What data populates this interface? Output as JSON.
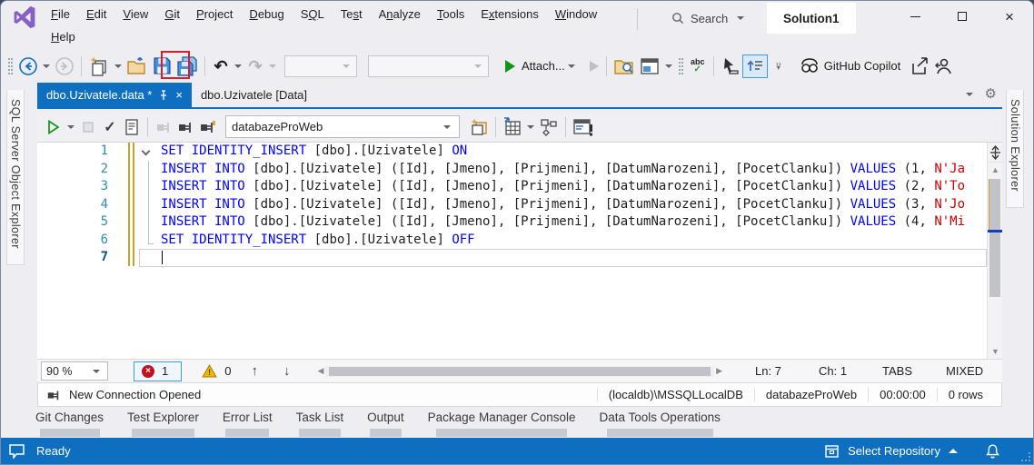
{
  "titlebar": {
    "menus": [
      {
        "label": "File",
        "u": 0
      },
      {
        "label": "Edit",
        "u": 0
      },
      {
        "label": "View",
        "u": 0
      },
      {
        "label": "Git",
        "u": 0
      },
      {
        "label": "Project",
        "u": 0
      },
      {
        "label": "Debug",
        "u": 0
      },
      {
        "label": "SQL",
        "u": 1
      },
      {
        "label": "Test",
        "u": 2
      },
      {
        "label": "Analyze",
        "u": 1
      },
      {
        "label": "Tools",
        "u": 0
      },
      {
        "label": "Extensions",
        "u": 1
      },
      {
        "label": "Window",
        "u": 0
      },
      {
        "label": "Help",
        "u": 0
      }
    ],
    "search_label": "Search",
    "solution_name": "Solution1"
  },
  "toolbar": {
    "attach_label": "Attach...",
    "copilot_label": "GitHub Copilot"
  },
  "side_panels": {
    "left": "SQL Server Object Explorer",
    "right": "Solution Explorer"
  },
  "tabs": [
    {
      "label": "dbo.Uzivatele.data *"
    },
    {
      "label": "dbo.Uzivatele [Data]"
    }
  ],
  "sql_toolbar": {
    "database": "databazeProWeb"
  },
  "editor": {
    "lines": [
      {
        "n": "1",
        "seg": [
          [
            "SET IDENTITY_INSERT",
            "k"
          ],
          [
            " [dbo].[Uzivatele] ",
            "p"
          ],
          [
            "ON",
            "k"
          ]
        ]
      },
      {
        "n": "2",
        "seg": [
          [
            "INSERT INTO",
            "k"
          ],
          [
            " [dbo].[Uzivatele] ([Id], [Jmeno], [Prijmeni], [DatumNarozeni], [PocetClanku]) ",
            "p"
          ],
          [
            "VALUES",
            "k"
          ],
          [
            " (1, ",
            "p"
          ],
          [
            "N'Ja",
            "s"
          ]
        ]
      },
      {
        "n": "3",
        "seg": [
          [
            "INSERT INTO",
            "k"
          ],
          [
            " [dbo].[Uzivatele] ([Id], [Jmeno], [Prijmeni], [DatumNarozeni], [PocetClanku]) ",
            "p"
          ],
          [
            "VALUES",
            "k"
          ],
          [
            " (2, ",
            "p"
          ],
          [
            "N'To",
            "s"
          ]
        ]
      },
      {
        "n": "4",
        "seg": [
          [
            "INSERT INTO",
            "k"
          ],
          [
            " [dbo].[Uzivatele] ([Id], [Jmeno], [Prijmeni], [DatumNarozeni], [PocetClanku]) ",
            "p"
          ],
          [
            "VALUES",
            "k"
          ],
          [
            " (3, ",
            "p"
          ],
          [
            "N'Jo",
            "s"
          ]
        ]
      },
      {
        "n": "5",
        "seg": [
          [
            "INSERT INTO",
            "k"
          ],
          [
            " [dbo].[Uzivatele] ([Id], [Jmeno], [Prijmeni], [DatumNarozeni], [PocetClanku]) ",
            "p"
          ],
          [
            "VALUES",
            "k"
          ],
          [
            " (4, ",
            "p"
          ],
          [
            "N'Mi",
            "s"
          ]
        ]
      },
      {
        "n": "6",
        "seg": [
          [
            "SET IDENTITY_INSERT",
            "k"
          ],
          [
            " [dbo].[Uzivatele] ",
            "p"
          ],
          [
            "OFF",
            "k"
          ]
        ]
      },
      {
        "n": "7",
        "seg": []
      }
    ]
  },
  "editor_status": {
    "zoom": "90 %",
    "error_count": "1",
    "warning_count": "0",
    "line": "Ln: 7",
    "column": "Ch: 1",
    "tabs_mode": "TABS",
    "line_endings": "MIXED"
  },
  "connection_bar": {
    "message": "New Connection Opened",
    "server": "(localdb)\\MSSQLLocalDB",
    "database": "databazeProWeb",
    "elapsed": "00:00:00",
    "rows": "0 rows"
  },
  "bottom_tabs": [
    "Git Changes",
    "Test Explorer",
    "Error List",
    "Task List",
    "Output",
    "Package Manager Console",
    "Data Tools Operations"
  ],
  "statusbar": {
    "ready": "Ready",
    "repository": "Select Repository"
  }
}
